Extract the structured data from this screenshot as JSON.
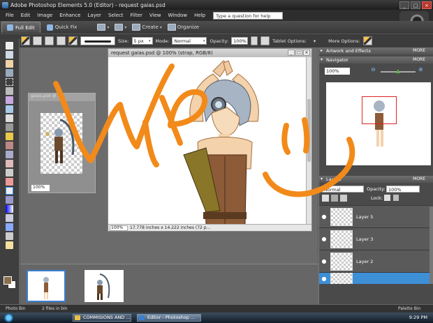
{
  "window": {
    "title": "Adobe Photoshop Elements 5.0 (Editor) - request gaias.psd"
  },
  "menu": {
    "items": [
      "File",
      "Edit",
      "Image",
      "Enhance",
      "Layer",
      "Select",
      "Filter",
      "View",
      "Window",
      "Help"
    ],
    "help_field": "Type a question for help"
  },
  "modebar": {
    "full_edit": "Full Edit",
    "quick_fix": "Quick Fix",
    "create": "Create",
    "organize": "Organize"
  },
  "options": {
    "size_label": "Size:",
    "size_value": "5 px",
    "mode_label": "Mode:",
    "mode_value": "Normal",
    "opacity_label": "Opacity:",
    "opacity_value": "100%",
    "tablet_label": "Tablet Options:",
    "more_label": "More Options:"
  },
  "doc_main": {
    "title": "request gaias.psd @ 100% (strap, RGB/8)",
    "zoom": "100%",
    "status": "17.778 inches x 14.222 inches (72 p..."
  },
  "doc_small": {
    "title": "gaias.psd @ ...",
    "zoom": "100%"
  },
  "panels": {
    "artwork": {
      "title": "Artwork and Effects",
      "more": "MORE"
    },
    "navigator": {
      "title": "Navigator",
      "more": "MORE",
      "zoom": "100%"
    },
    "layers": {
      "title": "Layers",
      "more": "MORE",
      "blend": "Normal",
      "opacity_label": "Opacity:",
      "opacity_value": "100%",
      "lock_label": "Lock:",
      "items": [
        {
          "name": "Layer 5"
        },
        {
          "name": "Layer 3"
        },
        {
          "name": "Layer 2"
        },
        {
          "name": ""
        }
      ]
    }
  },
  "statusbar": {
    "photo_bin": "Photo Bin",
    "files": "2 files in bin",
    "palette_bin": "Palette Bin"
  },
  "taskbar": {
    "items": [
      "COMMISIONS AND ...",
      "Editor - Photoshop ..."
    ],
    "clock": "9:29 PM"
  },
  "colors": {
    "accent": "#3d8fd6",
    "wip_overlay": "#f28a1a",
    "foreground_color": "#8a6e4d"
  }
}
